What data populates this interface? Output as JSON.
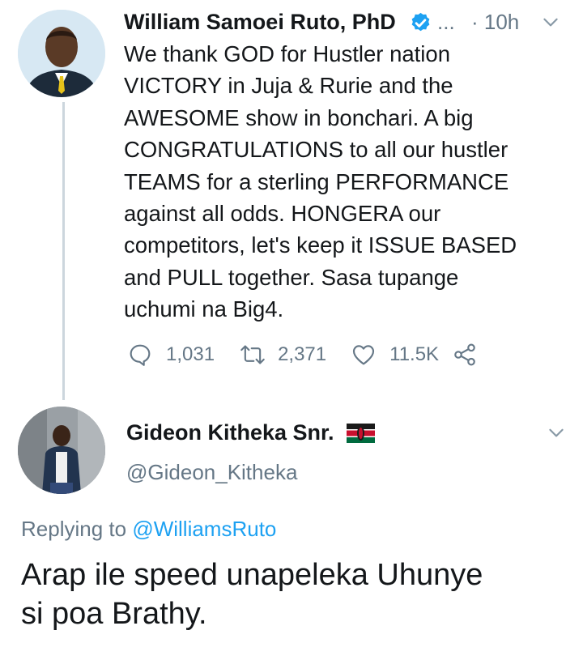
{
  "tweet": {
    "author_name": "William Samoei Ruto, PhD",
    "ellipsis": "...",
    "time": "· 10h",
    "text_lines": [
      "We thank GOD for Hustler nation",
      "VICTORY in Juja & Rurie and the",
      "AWESOME show in bonchari. A big",
      "CONGRATULATIONS to all our hustler",
      "TEAMS for a sterling PERFORMANCE",
      "against all odds. HONGERA our",
      "competitors, let's keep it ISSUE BASED",
      "and PULL together. Sasa tupange",
      "uchumi na Big4."
    ],
    "replies": "1,031",
    "retweets": "2,371",
    "likes": "11.5K",
    "icons": [
      "verified-icon",
      "chevron-down-icon",
      "reply-icon",
      "retweet-icon",
      "like-icon",
      "share-icon"
    ]
  },
  "reply": {
    "author_name": "Gideon Kitheka Snr.",
    "handle": "@Gideon_Kitheka",
    "replying_label": "Replying to",
    "replying_to": "@WilliamsRuto",
    "text_lines": [
      "Arap ile speed unapeleka Uhunye",
      "si poa Brathy."
    ],
    "icons": [
      "kenya-flag-icon",
      "chevron-down-icon"
    ]
  },
  "colors": {
    "verified_badge": "#1da1f2",
    "link": "#1da1f2",
    "secondary_text": "#657786",
    "thread_line": "#ccd6dd"
  }
}
